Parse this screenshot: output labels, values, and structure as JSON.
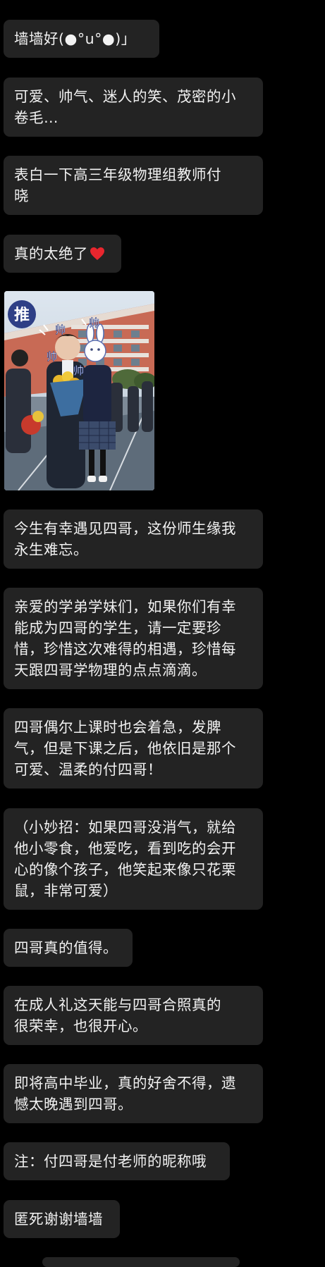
{
  "messages": [
    {
      "text": "墙墙好(●°u°●)」"
    },
    {
      "text": "可爱、帅气、迷人的笑、茂密的小\n卷毛…"
    },
    {
      "text": "表白一下高三年级物理组教师付\n晓"
    },
    {
      "text": "真的太绝了"
    },
    {
      "text": "今生有幸遇见四哥，这份师生缘我\n永生难忘。"
    },
    {
      "text": "亲爱的学弟学妹们，如果你们有幸\n能成为四哥的学生，请一定要珍\n惜，珍惜这次难得的相遇，珍惜每\n天跟四哥学物理的点点滴滴。"
    },
    {
      "text": "四哥偶尔上课时也会着急，发脾\n气，但是下课之后，他依旧是那个\n可爱、温柔的付四哥！"
    },
    {
      "text": "（小妙招：如果四哥没消气，就给\n他小零食，他爱吃，看到吃的会开\n心的像个孩子，他笑起来像只花栗\n鼠，非常可爱）"
    },
    {
      "text": "四哥真的值得。"
    },
    {
      "text": "在成人礼这天能与四哥合照真的\n很荣幸，也很开心。"
    },
    {
      "text": "即将高中毕业，真的好舍不得，遗\n憾太晚遇到四哥。"
    },
    {
      "text": "注：付四哥是付老师的昵称哦"
    },
    {
      "text": "匿死谢谢墙墙"
    }
  ],
  "photo": {
    "badge": "推",
    "doodles": [
      "帅",
      "帅",
      "帅",
      "帅"
    ]
  },
  "colors": {
    "background": "#000000",
    "bubble": "#232323",
    "text": "#f2f2f2",
    "heart": "#e8262e"
  }
}
